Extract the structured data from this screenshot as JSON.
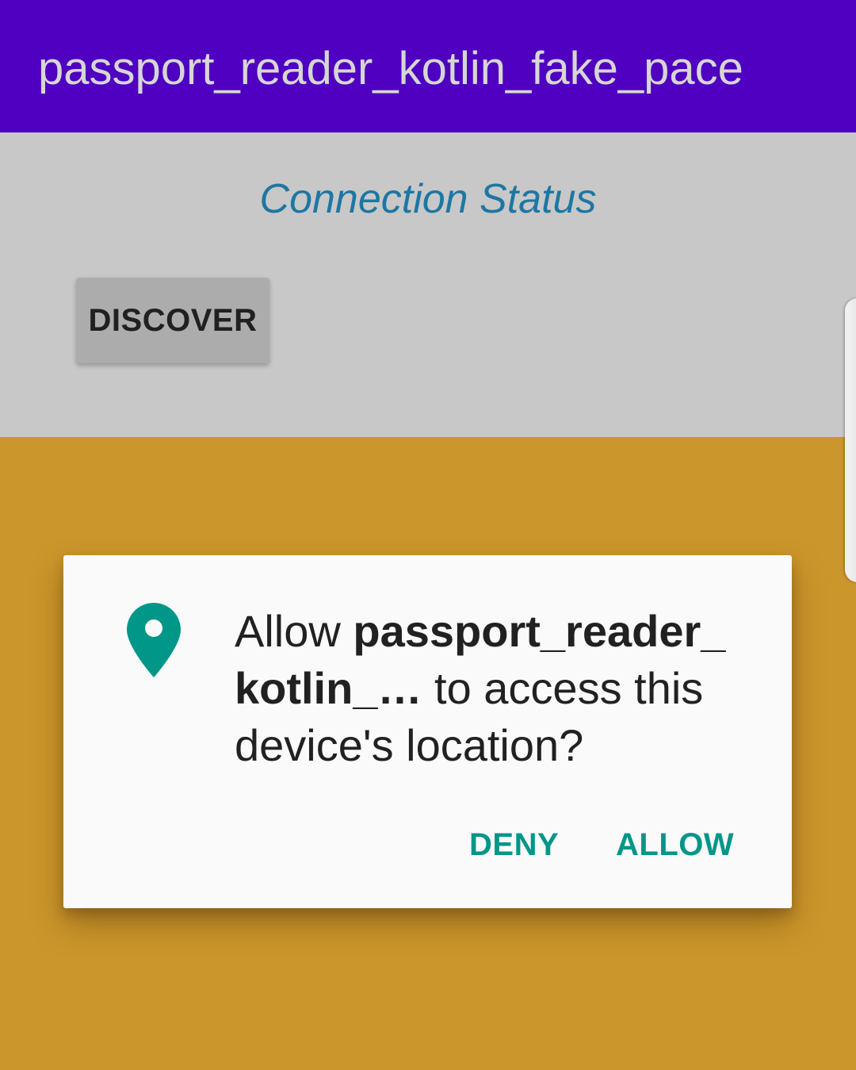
{
  "app_bar": {
    "title": "passport_reader_kotlin_fake_pace",
    "background_color": "#4f00c0"
  },
  "main": {
    "status_text": "Connection Status",
    "discover_label": "DISCOVER",
    "background_top": "#c8c8c8",
    "background_bottom": "#cb962b"
  },
  "dialog": {
    "icon": "location-pin-icon",
    "message_prefix": "Allow ",
    "app_name": "passport_reader_ kotlin_…",
    "message_suffix": " to access this device's location?",
    "deny_label": "DENY",
    "allow_label": "ALLOW",
    "accent_color": "#009688"
  }
}
